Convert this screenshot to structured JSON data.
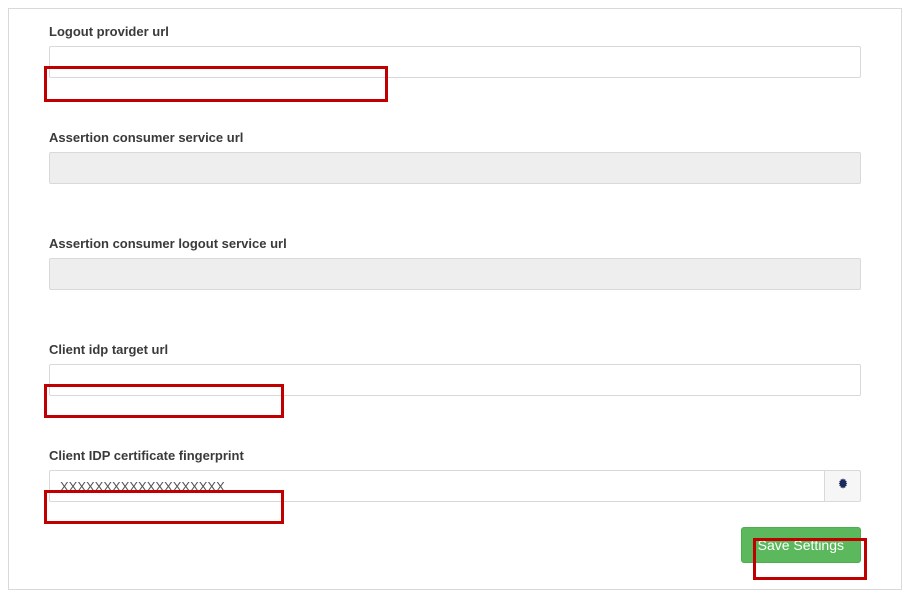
{
  "fields": {
    "logout_provider": {
      "label": "Logout provider url",
      "value": "",
      "placeholder": ""
    },
    "acs": {
      "label": "Assertion consumer service url",
      "value": "",
      "placeholder": ""
    },
    "acs_logout": {
      "label": "Assertion consumer logout service url",
      "value": "",
      "placeholder": ""
    },
    "idp_target": {
      "label": "Client idp target url",
      "value": "",
      "placeholder": ""
    },
    "idp_fingerprint": {
      "label": "Client IDP certificate fingerprint",
      "value": "XXXXXXXXXXXXXXXXXXX",
      "placeholder": ""
    }
  },
  "buttons": {
    "save": "Save Settings"
  }
}
